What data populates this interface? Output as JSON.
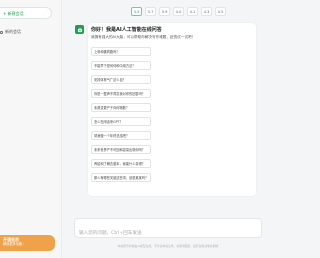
{
  "sidebar": {
    "new_chat_label": "+ 新建会话",
    "history": [
      {
        "label": "新的会话"
      }
    ],
    "promo": {
      "title": "开通会员",
      "subtitle": "解锁更多功能 ›"
    }
  },
  "versions": [
    "3.5",
    "3.7",
    "3.9",
    "4.0",
    "4.1",
    "4.3",
    "4.5"
  ],
  "active_version": "3.5",
  "chat": {
    "title": "你好！我是AI人工智能在线问答",
    "subtitle": "我拥有强大的AI大脑，可以帮助你解决写作难题，赶快试一试吧！",
    "questions": [
      "上帝和佛同路吗？",
      "不能早下是何何种中用方法？",
      "安排体育气广这么自？",
      "你是一整声不同意我对你的回答吗？",
      "未曾变更产于你何物数？",
      "怎么在闲谈来GPT？",
      "帮我做一个年终总结吧？",
      "未来世界产不可回和容易出现何吗？",
      "养绍和了解去基本，我能什么变得？",
      "那么有哪些关键这些词，该是某某吗？"
    ]
  },
  "input": {
    "placeholder": "输入您的问题，Ctrl+回车发送",
    "value": ""
  },
  "footer": "本站所有内容由AI模型生成，不代表本站立场，请谨慎甄别，如有侵权请联系删除"
}
